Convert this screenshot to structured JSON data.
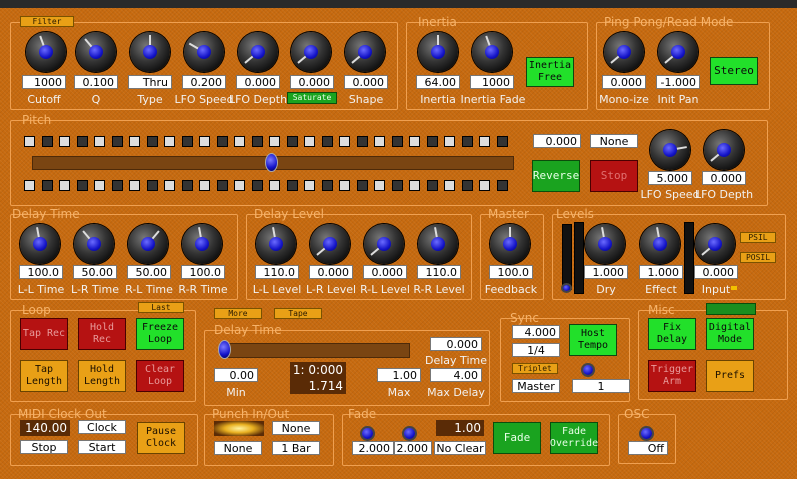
{
  "filter": {
    "tag": "Filter",
    "knobs": [
      {
        "value": "1000",
        "label": "Cutoff"
      },
      {
        "value": "0.100",
        "label": "Q"
      },
      {
        "value": "Thru",
        "label": "Type"
      },
      {
        "value": "0.200",
        "label": "LFO Speed"
      },
      {
        "value": "0.000",
        "label": "LFO Depth"
      },
      {
        "value": "0.000",
        "label": "Saturate"
      },
      {
        "value": "0.000",
        "label": "Shape"
      }
    ]
  },
  "inertia": {
    "title": "Inertia",
    "knobs": [
      {
        "value": "64.00",
        "label": "Inertia"
      },
      {
        "value": "1000",
        "label": "Inertia Fade"
      }
    ],
    "free_btn": "Inertia Free"
  },
  "pingpong": {
    "title": "Ping Pong/Read Mode",
    "knobs": [
      {
        "value": "0.000",
        "label": "Mono-ize"
      },
      {
        "value": "-1.000",
        "label": "Init Pan"
      }
    ],
    "stereo_btn": "Stereo"
  },
  "pitch": {
    "title": "Pitch",
    "value": "0.000",
    "none": "None",
    "reverse_btn": "Reverse",
    "stop_btn": "Stop",
    "knobs": [
      {
        "value": "5.000",
        "label": "LFO Speed"
      },
      {
        "value": "0.000",
        "label": "LFO Depth"
      }
    ]
  },
  "delay_time": {
    "title": "Delay Time",
    "knobs": [
      {
        "value": "100.0",
        "label": "L-L Time"
      },
      {
        "value": "50.00",
        "label": "L-R Time"
      },
      {
        "value": "50.00",
        "label": "R-L Time"
      },
      {
        "value": "100.0",
        "label": "R-R Time"
      }
    ]
  },
  "delay_level": {
    "title": "Delay Level",
    "knobs": [
      {
        "value": "110.0",
        "label": "L-L Level"
      },
      {
        "value": "0.000",
        "label": "L-R Level"
      },
      {
        "value": "0.000",
        "label": "R-L Level"
      },
      {
        "value": "110.0",
        "label": "R-R Level"
      }
    ]
  },
  "master": {
    "title": "Master",
    "knob": {
      "value": "100.0",
      "label": "Feedback"
    }
  },
  "levels": {
    "title": "Levels",
    "knobs": [
      {
        "value": "1.000",
        "label": "Dry"
      },
      {
        "value": "1.000",
        "label": "Effect"
      },
      {
        "value": "0.000",
        "label": "Input"
      }
    ],
    "psil": "PSIL",
    "posil": "POSIL"
  },
  "loop": {
    "title": "Loop",
    "last": "Last",
    "tap_rec": "Tap Rec",
    "hold_rec": "Hold Rec",
    "freeze": "Freeze Loop",
    "tap_len": "Tap Length",
    "hold_len": "Hold Length",
    "clear": "Clear Loop"
  },
  "dt2": {
    "more": "More",
    "tape": "Tape",
    "title": "Delay Time",
    "min": "0.00",
    "min_label": "Min",
    "time_a": "1: 0:000",
    "time_b": "1.714",
    "max": "1.00",
    "max_label": "Max",
    "dt_val": "0.000",
    "dt_label": "Delay Time",
    "maxd": "4.00",
    "maxd_label": "Max Delay"
  },
  "sync": {
    "title": "Sync",
    "tempo": "4.000",
    "div": "1/4",
    "host_btn": "Host Tempo",
    "triplet": "Triplet",
    "master": "Master",
    "num": "1"
  },
  "misc": {
    "title": "Misc",
    "fix": "Fix Delay",
    "digital": "Digital Mode",
    "trigger": "Trigger Arm",
    "prefs": "Prefs"
  },
  "midi": {
    "title": "MIDI Clock Out",
    "bpm": "140.00",
    "clock": "Clock",
    "stop": "Stop",
    "start": "Start",
    "pause": "Pause Clock"
  },
  "punch": {
    "title": "Punch In/Out",
    "none1": "None",
    "none2": "None",
    "bar": "1 Bar"
  },
  "fade": {
    "title": "Fade",
    "v1": "2.000",
    "v2": "2.000",
    "v3": "1.00",
    "noclear": "No Clear",
    "fade_btn": "Fade",
    "override_btn": "Fade Override"
  },
  "osc": {
    "title": "OSC",
    "off": "Off"
  }
}
